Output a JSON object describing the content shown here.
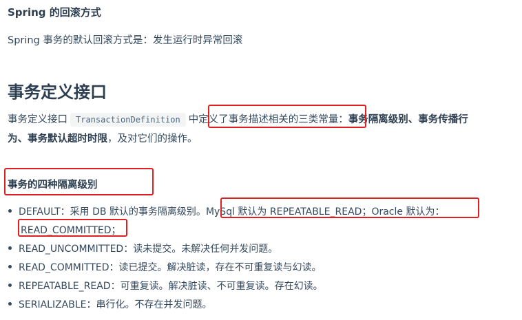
{
  "section1": {
    "heading": "Spring 的回滚方式",
    "paragraph": "Spring 事务的默认回滚方式是：发生运行时异常回滚"
  },
  "section2": {
    "heading": "事务定义接口",
    "para_prefix": "事务定义接口",
    "code": "TransactionDefinition",
    "para_mid1": "中",
    "para_highlight": "定义了事务描述相关的三类常量",
    "para_colon": "：",
    "bold_line1": "事务隔离级别、事务传播行",
    "bold_line2": "为、事务默认超时时限",
    "para_suffix": "，及对它们的操作。"
  },
  "section3": {
    "heading": "事务的四种隔离级别",
    "items": [
      {
        "text_a": "DEFAULT：采用 DB 默认的事务隔离级别。",
        "text_b": "MySql 默认为 REPEATABLE_READ；Oracle 默认为：",
        "text_c": "READ_COMMITTED；"
      },
      {
        "text": "READ_UNCOMMITTED：读未提交。未解决任何并发问题。"
      },
      {
        "text": "READ_COMMITTED：读已提交。解决脏读，存在不可重复读与幻读。"
      },
      {
        "text": "REPEATABLE_READ：可重复读。解决脏读、不可重复读。存在幻读。"
      },
      {
        "text": "SERIALIZABLE：串行化。不存在并发问题。"
      }
    ]
  },
  "colors": {
    "annotation_box": "#e02020",
    "text": "#34495e",
    "heading": "#2c3e50"
  }
}
